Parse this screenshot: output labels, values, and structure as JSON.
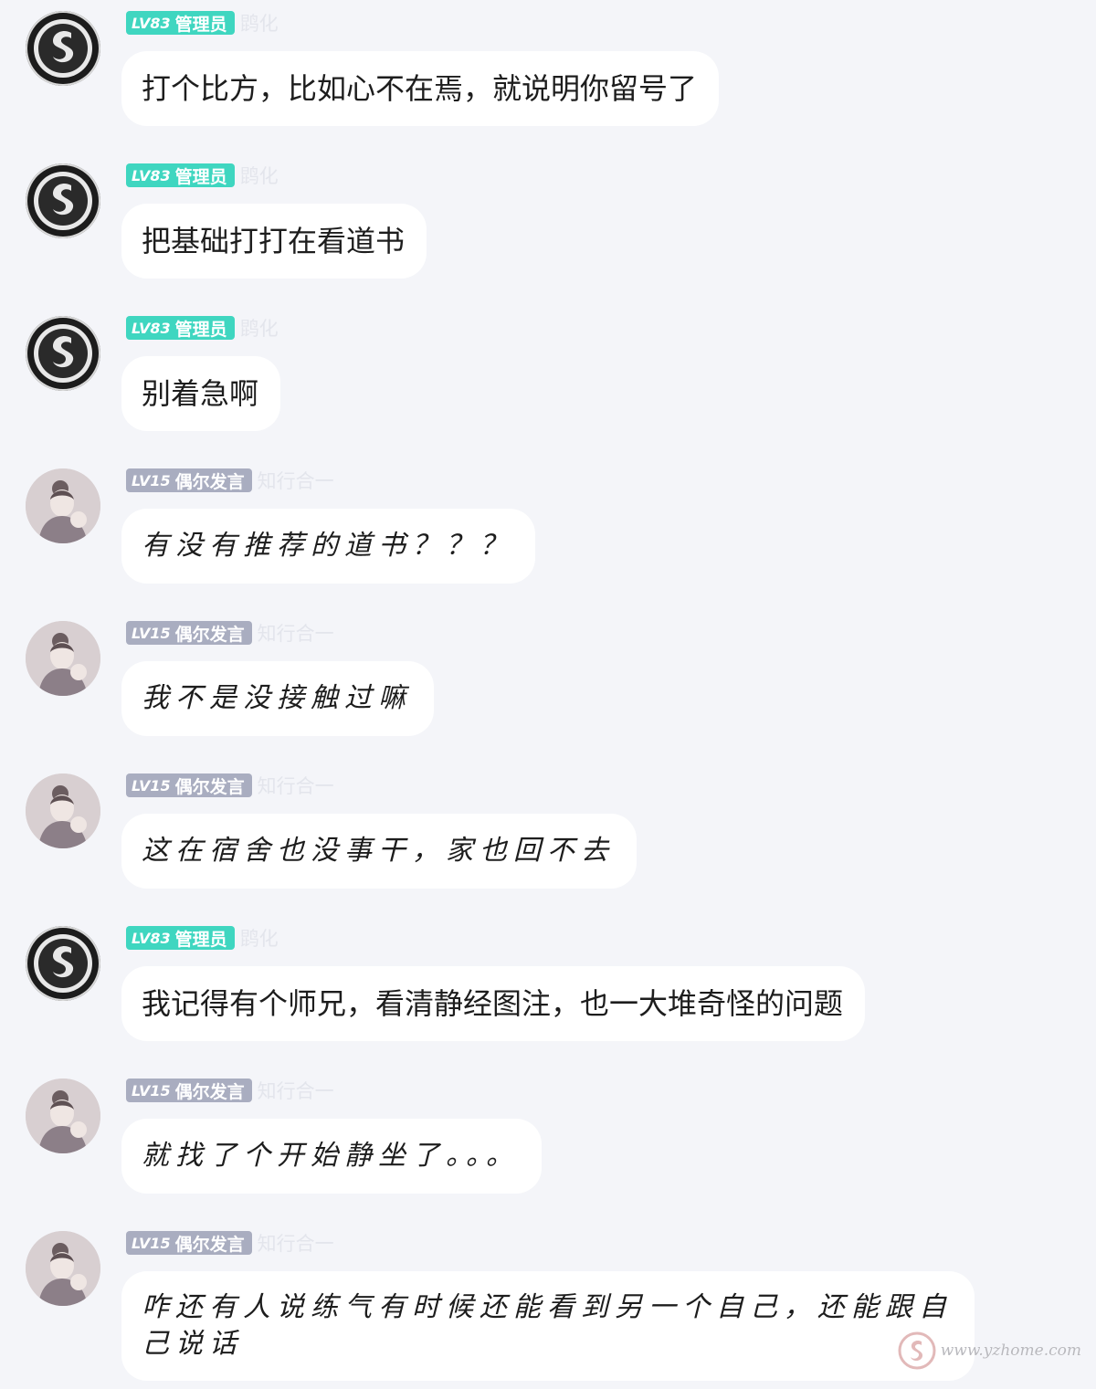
{
  "roles": {
    "admin": {
      "level": "LV83",
      "title": "管理员",
      "nickname": "鹍化"
    },
    "user": {
      "level": "LV15",
      "title": "偶尔发言",
      "nickname": "知行合一"
    }
  },
  "messages": [
    {
      "role": "admin",
      "text": "打个比方，比如心不在焉，就说明你留号了"
    },
    {
      "role": "admin",
      "text": "把基础打打在看道书"
    },
    {
      "role": "admin",
      "text": "别着急啊"
    },
    {
      "role": "user",
      "text": "有没有推荐的道书？？？"
    },
    {
      "role": "user",
      "text": "我不是没接触过嘛"
    },
    {
      "role": "user",
      "text": "这在宿舍也没事干，家也回不去"
    },
    {
      "role": "admin",
      "text": "我记得有个师兄，看清静经图注，也一大堆奇怪的问题"
    },
    {
      "role": "user",
      "text": "就找了个开始静坐了。。。"
    },
    {
      "role": "user",
      "text": "咋还有人说练气有时候还能看到另一个自己，还能跟自己说话"
    }
  ],
  "icons": {
    "admin_avatar": "swan-logo-avatar-icon",
    "user_avatar": "portrait-avatar-icon",
    "watermark_logo": "swan-logo-icon"
  },
  "colors": {
    "admin_badge": "#3fd6c0",
    "user_badge": "#a9adc0",
    "background": "#f4f5f9",
    "bubble": "#ffffff"
  },
  "watermark": {
    "text": "www.yzhome.com"
  }
}
